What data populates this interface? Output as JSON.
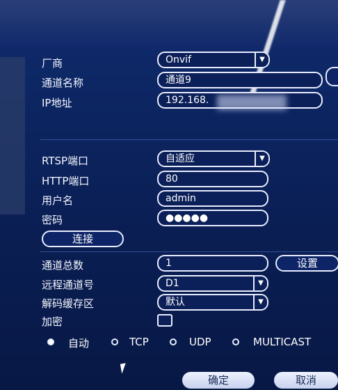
{
  "form": {
    "manufacturer": {
      "label": "厂商",
      "value": "Onvif"
    },
    "channel_name": {
      "label": "通道名称",
      "value": "通道9"
    },
    "ip": {
      "label": "IP地址",
      "value": "192.168."
    },
    "rtsp_port": {
      "label": "RTSP端口",
      "value": "自适应"
    },
    "http_port": {
      "label": "HTTP端口",
      "value": "80"
    },
    "username": {
      "label": "用户名",
      "value": "admin"
    },
    "password": {
      "label": "密码",
      "value": "●●●●●"
    },
    "connect_label": "连接",
    "total_channels": {
      "label": "通道总数",
      "value": "1",
      "settings_label": "设置"
    },
    "remote_channel": {
      "label": "远程通道号",
      "value": "D1"
    },
    "decode_buffer": {
      "label": "解码缓存区",
      "value": "默认"
    },
    "encrypt": {
      "label": "加密"
    }
  },
  "protocol": {
    "options": [
      "自动",
      "TCP",
      "UDP",
      "MULTICAST"
    ],
    "selected": "自动"
  },
  "footer": {
    "ok_label": "确定",
    "cancel_label": "取消"
  },
  "icons": {
    "dropdown": "chevron-down-icon",
    "cursor": "mouse-pointer-icon"
  }
}
